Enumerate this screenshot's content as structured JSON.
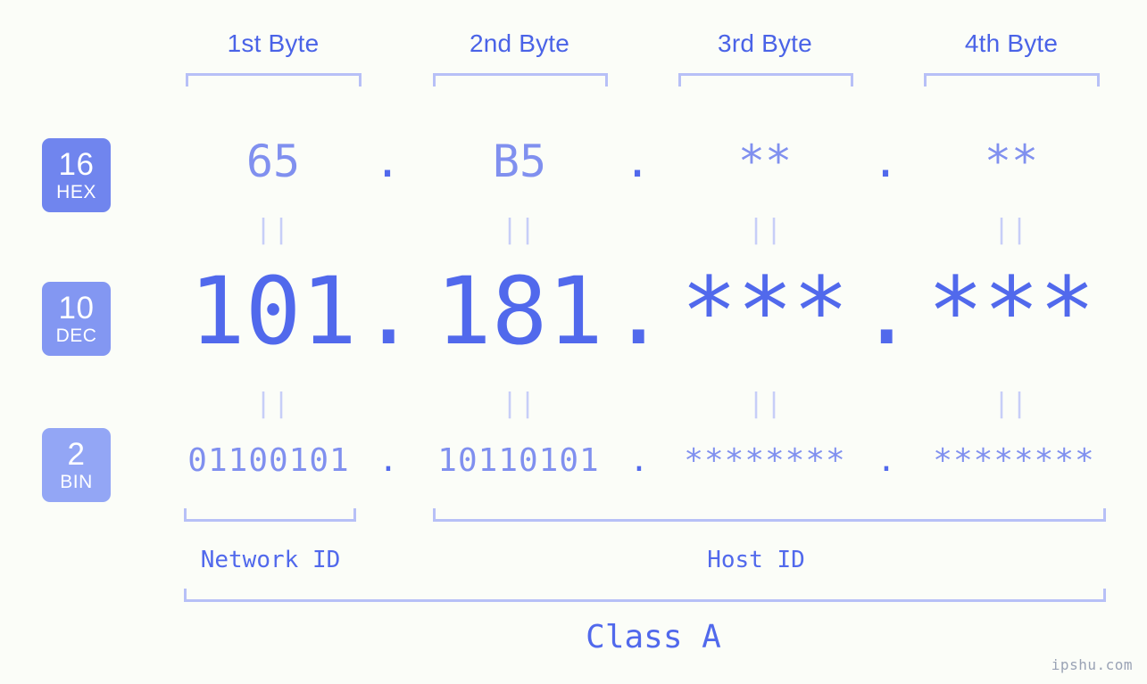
{
  "colors": {
    "background": "#fbfdf8",
    "accent_strong": "#5169ec",
    "accent_mid": "#8090ef",
    "bracket": "#b7c0f7",
    "equals": "#c7cef8",
    "badge_hex": "#7085ee",
    "badge_dec": "#8397f2",
    "badge_bin": "#93a6f5",
    "watermark": "#9aa3b5"
  },
  "header": {
    "bytes": [
      {
        "label": "1st Byte"
      },
      {
        "label": "2nd Byte"
      },
      {
        "label": "3rd Byte"
      },
      {
        "label": "4th Byte"
      }
    ]
  },
  "bases": [
    {
      "number": "16",
      "abbr": "HEX"
    },
    {
      "number": "10",
      "abbr": "DEC"
    },
    {
      "number": "2",
      "abbr": "BIN"
    }
  ],
  "rows": {
    "hex": {
      "values": [
        "65",
        "B5",
        "**",
        "**"
      ],
      "separators": [
        ".",
        ".",
        "."
      ]
    },
    "dec": {
      "values": [
        "101",
        "181",
        "***",
        "***"
      ],
      "separators": [
        ".",
        ".",
        "."
      ]
    },
    "bin": {
      "values": [
        "01100101",
        "10110101",
        "********",
        "********"
      ],
      "separators": [
        ".",
        ".",
        "."
      ]
    }
  },
  "equals_marks": {
    "glyph": "||",
    "count_per_row": 4,
    "rows": 2
  },
  "segments": {
    "network_id": "Network ID",
    "host_id": "Host ID"
  },
  "class": {
    "label": "Class A"
  },
  "watermark": {
    "text": "ipshu.com"
  }
}
